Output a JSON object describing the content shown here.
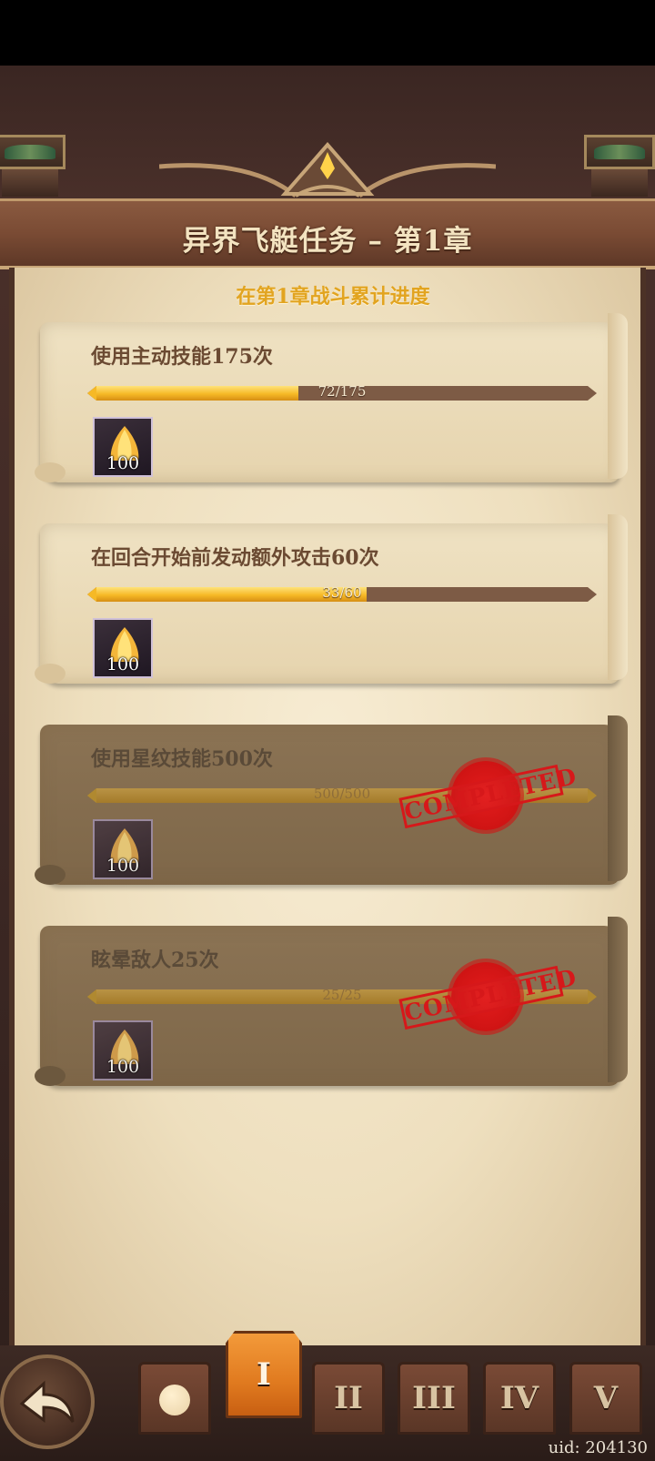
{
  "header": {
    "title": "异界飞艇任务 – 第1章",
    "subtitle": "在第1章战斗累计进度"
  },
  "tasks": [
    {
      "name": "使用主动技能175次",
      "current": 72,
      "total": 175,
      "progress_text": "72/175",
      "reward_qty": "100",
      "completed": false
    },
    {
      "name": "在回合开始前发动额外攻击60次",
      "current": 33,
      "total": 60,
      "progress_text": "33/60",
      "reward_qty": "100",
      "completed": false
    },
    {
      "name": "使用星纹技能500次",
      "current": 500,
      "total": 500,
      "progress_text": "500/500",
      "reward_qty": "100",
      "completed": true,
      "stamp": "COMPLETED"
    },
    {
      "name": "眩晕敌人25次",
      "current": 25,
      "total": 25,
      "progress_text": "25/25",
      "reward_qty": "100",
      "completed": true,
      "stamp": "COMPLETED"
    }
  ],
  "reward_icon": "crystal-shard-icon",
  "nav": {
    "back_icon": "back-arrow-icon",
    "tabs": [
      "I",
      "II",
      "III",
      "IV",
      "V"
    ],
    "active_tab": "I",
    "first_tab_icon": "circle-icon"
  },
  "footer": {
    "uid": "uid: 204130"
  },
  "colors": {
    "accent": "#e2a420",
    "stamp_red": "#d6181a",
    "active_tab": "#e07a1f"
  }
}
